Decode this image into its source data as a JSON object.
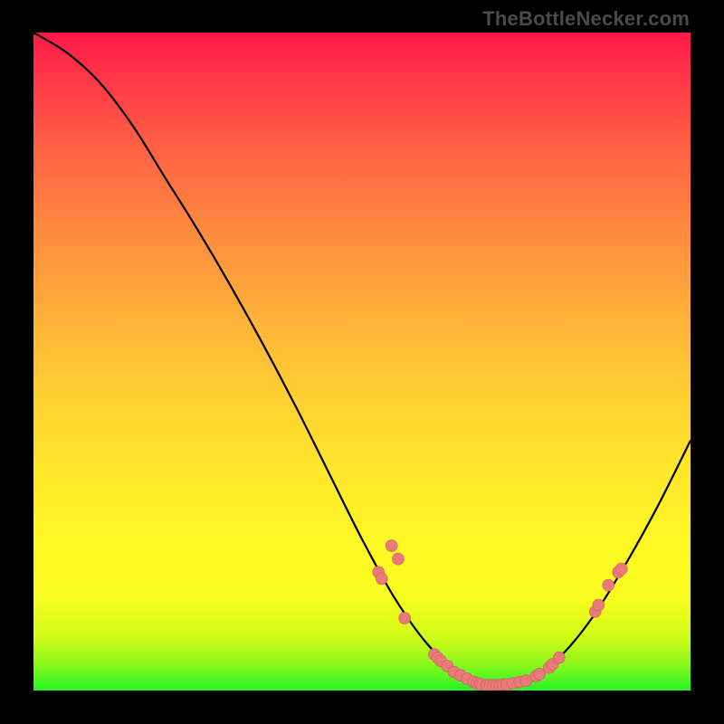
{
  "attribution": "TheBottleNecker.com",
  "colors": {
    "background": "#000000",
    "gradient_top": "#ff1a47",
    "gradient_bottom": "#26f425",
    "curve_stroke": "#000000",
    "marker_fill": "#e97a7a",
    "marker_stroke": "#cf5f5f"
  },
  "chart_data": {
    "type": "line",
    "title": "",
    "xlabel": "",
    "ylabel": "",
    "xlim": [
      0,
      100
    ],
    "ylim": [
      0,
      100
    ],
    "curve": [
      {
        "x": 0.0,
        "y": 100.0
      },
      {
        "x": 5.0,
        "y": 97.0
      },
      {
        "x": 10.0,
        "y": 92.5
      },
      {
        "x": 15.0,
        "y": 86.0
      },
      {
        "x": 20.0,
        "y": 78.0
      },
      {
        "x": 25.0,
        "y": 70.0
      },
      {
        "x": 30.0,
        "y": 61.5
      },
      {
        "x": 35.0,
        "y": 52.5
      },
      {
        "x": 40.0,
        "y": 43.0
      },
      {
        "x": 45.0,
        "y": 33.0
      },
      {
        "x": 50.0,
        "y": 23.0
      },
      {
        "x": 55.0,
        "y": 14.0
      },
      {
        "x": 60.0,
        "y": 7.0
      },
      {
        "x": 65.0,
        "y": 2.5
      },
      {
        "x": 70.0,
        "y": 0.8
      },
      {
        "x": 75.0,
        "y": 1.5
      },
      {
        "x": 80.0,
        "y": 5.0
      },
      {
        "x": 85.0,
        "y": 11.0
      },
      {
        "x": 90.0,
        "y": 19.0
      },
      {
        "x": 95.0,
        "y": 28.0
      },
      {
        "x": 100.0,
        "y": 38.0
      }
    ],
    "markers": [
      {
        "x": 52.5,
        "y": 18.0
      },
      {
        "x": 53.0,
        "y": 17.0
      },
      {
        "x": 54.5,
        "y": 22.0
      },
      {
        "x": 55.5,
        "y": 20.0
      },
      {
        "x": 56.5,
        "y": 11.0
      },
      {
        "x": 61.0,
        "y": 5.5
      },
      {
        "x": 61.5,
        "y": 5.0
      },
      {
        "x": 62.0,
        "y": 4.5
      },
      {
        "x": 63.0,
        "y": 3.7
      },
      {
        "x": 64.0,
        "y": 2.8
      },
      {
        "x": 65.0,
        "y": 2.3
      },
      {
        "x": 66.0,
        "y": 1.8
      },
      {
        "x": 67.0,
        "y": 1.3
      },
      {
        "x": 67.5,
        "y": 1.1
      },
      {
        "x": 68.0,
        "y": 1.0
      },
      {
        "x": 69.0,
        "y": 0.8
      },
      {
        "x": 69.5,
        "y": 0.8
      },
      {
        "x": 70.0,
        "y": 0.8
      },
      {
        "x": 70.5,
        "y": 0.8
      },
      {
        "x": 71.0,
        "y": 0.8
      },
      {
        "x": 71.5,
        "y": 0.9
      },
      {
        "x": 72.0,
        "y": 0.9
      },
      {
        "x": 73.0,
        "y": 1.1
      },
      {
        "x": 74.0,
        "y": 1.3
      },
      {
        "x": 75.0,
        "y": 1.5
      },
      {
        "x": 76.5,
        "y": 2.2
      },
      {
        "x": 77.0,
        "y": 2.5
      },
      {
        "x": 78.5,
        "y": 3.5
      },
      {
        "x": 79.0,
        "y": 4.0
      },
      {
        "x": 80.0,
        "y": 5.0
      },
      {
        "x": 85.5,
        "y": 12.0
      },
      {
        "x": 86.0,
        "y": 13.0
      },
      {
        "x": 87.5,
        "y": 16.0
      },
      {
        "x": 89.0,
        "y": 18.0
      },
      {
        "x": 89.5,
        "y": 18.5
      }
    ]
  }
}
